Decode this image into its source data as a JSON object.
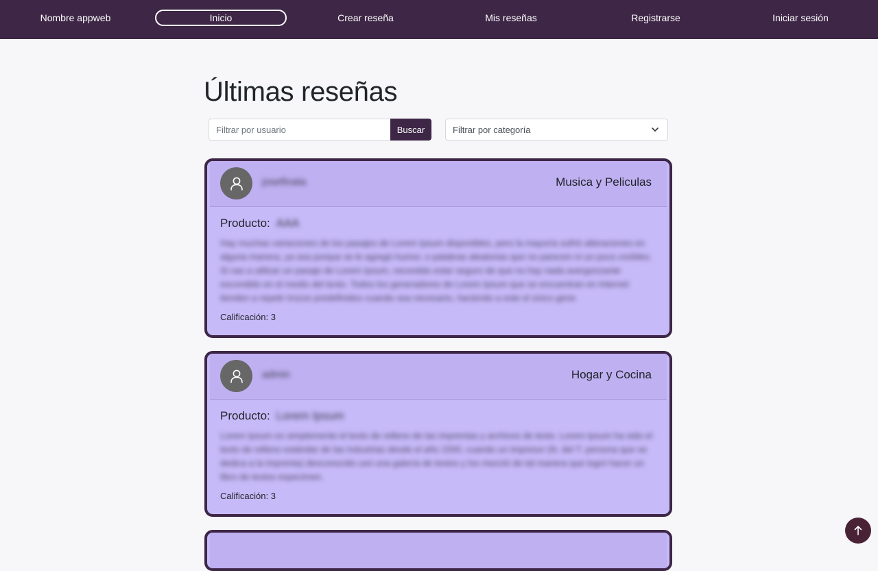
{
  "nav": {
    "brand": "Nombre appweb",
    "items": [
      {
        "label": "Inicio",
        "active": true
      },
      {
        "label": "Crear reseña",
        "active": false
      },
      {
        "label": "Mis reseñas",
        "active": false
      },
      {
        "label": "Registrarse",
        "active": false
      },
      {
        "label": "Iniciar sesión",
        "active": false
      }
    ]
  },
  "page": {
    "title": "Últimas reseñas"
  },
  "filters": {
    "user_placeholder": "Filtrar por usuario",
    "search_label": "Buscar",
    "category_placeholder": "Filtrar por categoría"
  },
  "reviews": [
    {
      "username": "josefinata",
      "category": "Musica y Peliculas",
      "product_label": "Producto:",
      "product": "AAA",
      "text": "Hay muchas variaciones de los pasajes de Lorem Ipsum disponibles, pero la mayoría sufrió alteraciones en alguna manera, ya sea porque se le agregó humor, o palabras aleatorias que no parecen ni un poco creíbles. Si vas a utilizar un pasaje de Lorem Ipsum, necesitás estar seguro de que no hay nada avergonzante escondido en el medio del texto. Todos los generadores de Lorem Ipsum que se encuentran en Internet tienden a repetir trozos predefinidos cuando sea necesario, haciendo a este el único gene",
      "rating": "Calificación: 3"
    },
    {
      "username": "admin",
      "category": "Hogar y Cocina",
      "product_label": "Producto:",
      "product": "Lorem Ipsum",
      "text": "Lorem Ipsum es simplemente el texto de relleno de las imprentas y archivos de texto. Lorem Ipsum ha sido el texto de relleno estándar de las industrias desde el año 1500, cuando un impresor (N. del T. persona que se dedica a la imprenta) desconocido usó una galería de textos y los mezcló de tal manera que logró hacer un libro de textos especimen.",
      "rating": "Calificación: 3"
    }
  ],
  "colors": {
    "navbar": "#3d2646",
    "card_background": "#c7baf9",
    "card_header": "#bfb0f2",
    "card_border": "#3d2646",
    "avatar": "#676767",
    "scroll_top_button": "#4a2236"
  },
  "icons": {
    "avatar": "user-icon",
    "select": "chevron-down-icon",
    "scroll_top": "arrow-up-icon"
  }
}
